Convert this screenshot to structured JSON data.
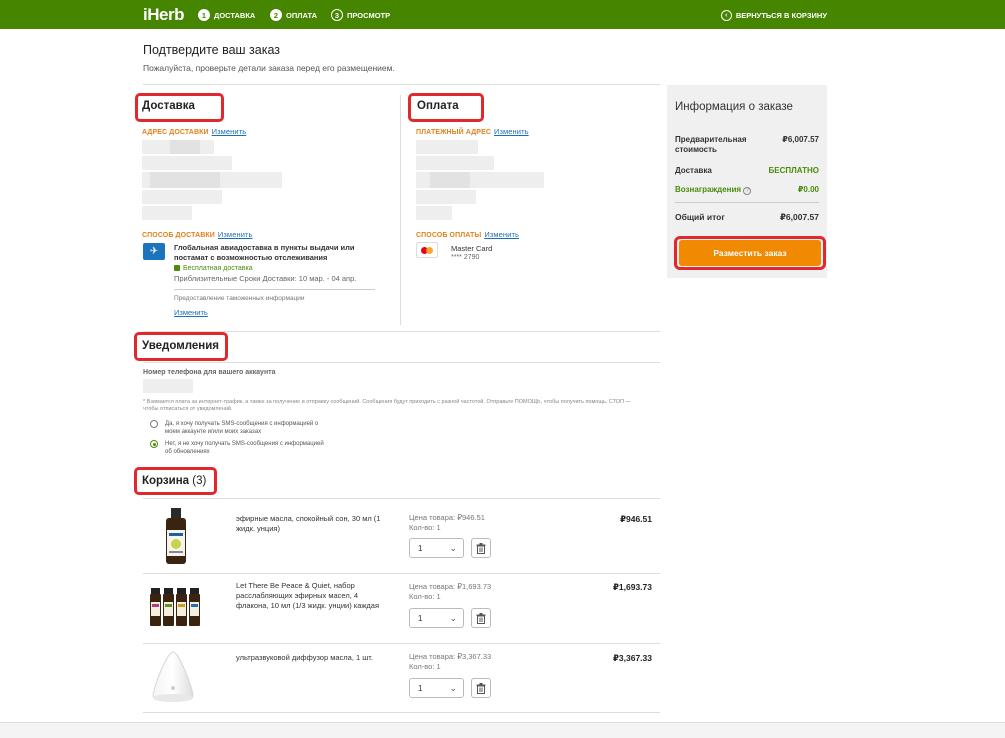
{
  "header": {
    "logo": "iHerb",
    "steps": [
      {
        "num": "1",
        "label": "ДОСТАВКА"
      },
      {
        "num": "2",
        "label": "ОПЛАТА"
      },
      {
        "num": "3",
        "label": "ПРОСМОТР"
      }
    ],
    "back_label": "ВЕРНУТЬСЯ В КОРЗИНУ"
  },
  "page": {
    "title": "Подтвердите ваш заказ",
    "subtitle": "Пожалуйста, проверьте детали заказа перед его размещением."
  },
  "delivery": {
    "title": "Доставка",
    "address_label": "АДРЕС ДОСТАВКИ",
    "change": "Изменить",
    "method_label": "СПОСОБ ДОСТАВКИ",
    "method_name": "Глобальная авиадоставка в пункты выдачи или постамат с возможностью отслеживания",
    "free_shipping": "Бесплатная доставка",
    "eta": "Приблизительные Сроки Доставки: 10 мар. - 04 апр.",
    "customs": "Предоставление таможенных информации"
  },
  "payment": {
    "title": "Оплата",
    "billing_label": "ПЛАТЕЖНЫЙ АДРЕС",
    "change": "Изменить",
    "method_label": "СПОСОБ ОПЛАТЫ",
    "card_name": "Master Card",
    "card_number": "**** 2790"
  },
  "summary": {
    "title": "Информация о заказе",
    "rows": [
      {
        "label": "Предварительная стоимость",
        "value": "₽6,007.57"
      },
      {
        "label": "Доставка",
        "value": "БЕСПЛАТНО"
      },
      {
        "label": "Вознаграждения",
        "value": "₽0.00"
      },
      {
        "label": "Общий итог",
        "value": "₽6,007.57"
      }
    ],
    "order_button": "Разместить заказ"
  },
  "notifications": {
    "title": "Уведомления",
    "phone_label": "Номер телефона для вашего аккаунта",
    "disclaimer": "* Взимается плата за интернет-трафик, а также за получение и отправку сообщений. Сообщения будут приходить с разной частотой. Отправьте ПОМОЩЬ, чтобы получить помощь, СТОП — чтобы отписаться от уведомлений.",
    "option_yes": "Да, я хочу получать SMS-сообщения с информацией о моем аккаунте и/или моих заказах",
    "option_no": "Нет, я не хочу получать SMS-сообщения с информацией об обновлениях"
  },
  "cart": {
    "title": "Корзина",
    "count": "(3)",
    "items": [
      {
        "name": "эфирные масла, спокойный сон, 30 мл (1 жидк. унция)",
        "unit_price": "Цена товара: ₽946.51",
        "qty_label": "Кол-во: 1",
        "qty": "1",
        "price": "₽946.51"
      },
      {
        "name": "Let There Be Peace & Quiet, набор расслабляющих эфирных масел, 4 флакона, 10 мл (1/3 жидк. унции) каждая",
        "unit_price": "Цена товара: ₽1,693.73",
        "qty_label": "Кол-во: 1",
        "qty": "1",
        "price": "₽1,693.73"
      },
      {
        "name": "ультразвуковой диффузор масла, 1 шт.",
        "unit_price": "Цена товара: ₽3,367.33",
        "qty_label": "Кол-во: 1",
        "qty": "1",
        "price": "₽3,367.33"
      }
    ]
  },
  "colors": {
    "brand": "#458500",
    "accent": "#f18a00",
    "highlight": "#e0282e",
    "link": "#1a6fb5"
  }
}
